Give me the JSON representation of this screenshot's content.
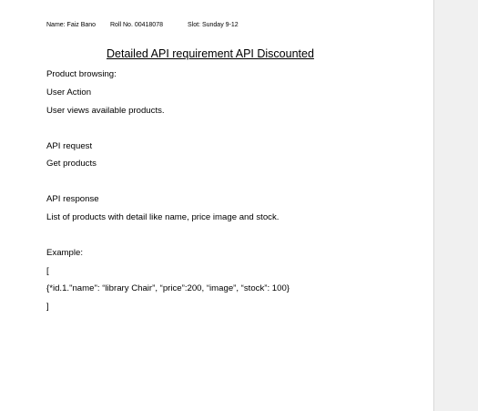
{
  "header": {
    "name": "Name: Faiz Bano",
    "roll": "Roll No. 00418078",
    "slot": "Slot:  Sunday 9-12"
  },
  "title": "Detailed API requirement API Discounted",
  "lines": [
    "Product browsing:",
    "User Action",
    "User views available products.",
    "API request",
    "Get products",
    "API response",
    "List of products with detail like name, price image and stock.",
    "Example:",
    "[",
    "{*id.1.\"name\": “library Chair”, “price”:200, “image”, “stock”: 100}",
    "]"
  ]
}
